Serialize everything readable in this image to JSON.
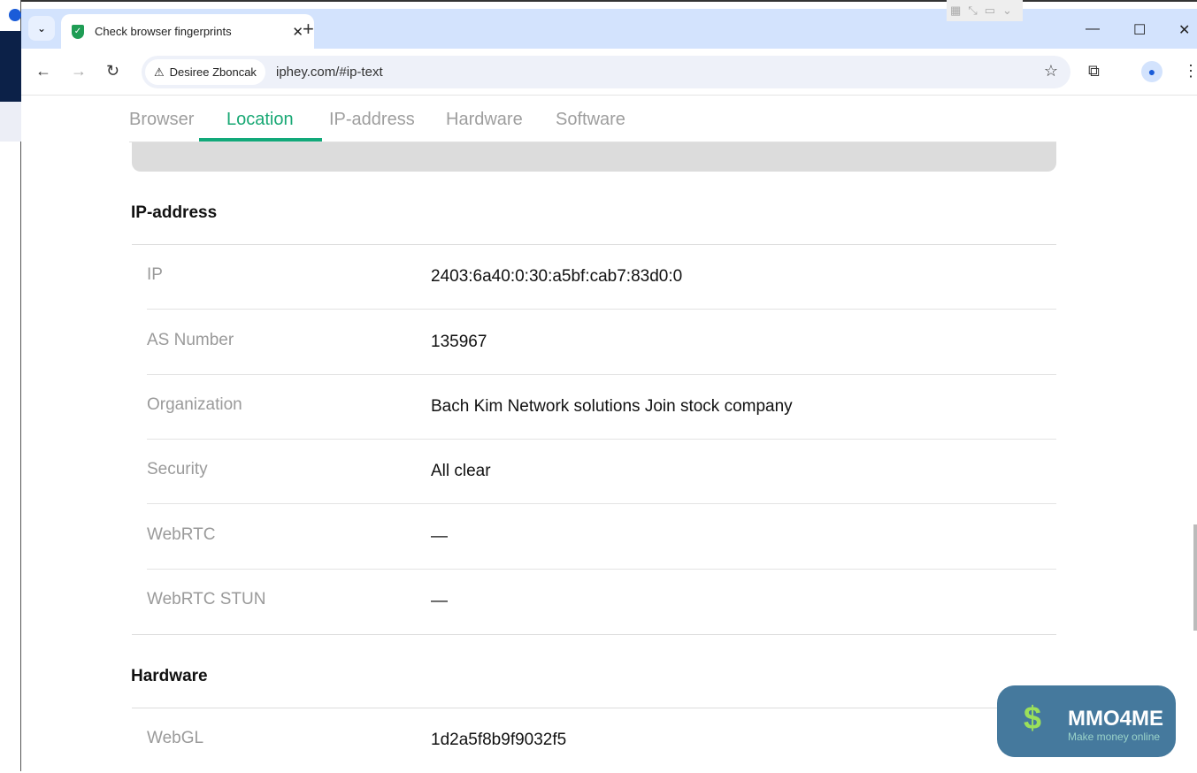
{
  "browser": {
    "tab_title": "Check browser fingerprints",
    "profile_chip": "Desiree Zboncak",
    "url": "iphey.com/#ip-text"
  },
  "nav_tabs": [
    {
      "label": "Browser"
    },
    {
      "label": "Location"
    },
    {
      "label": "IP-address"
    },
    {
      "label": "Hardware"
    },
    {
      "label": "Software"
    }
  ],
  "active_tab": "Location",
  "ip_section": {
    "title": "IP-address",
    "rows": [
      {
        "label": "IP",
        "value": "2403:6a40:0:30:a5bf:cab7:83d0:0"
      },
      {
        "label": "AS Number",
        "value": "135967"
      },
      {
        "label": "Organization",
        "value": "Bach Kim Network solutions Join stock company"
      },
      {
        "label": "Security",
        "value": "All clear"
      },
      {
        "label": "WebRTC",
        "value": "—"
      },
      {
        "label": "WebRTC STUN",
        "value": "—"
      }
    ]
  },
  "hardware_section": {
    "title": "Hardware",
    "rows": [
      {
        "label": "WebGL",
        "value": "1d2a5f8b9f9032f5"
      }
    ]
  },
  "watermark": {
    "title": "MMO4ME",
    "subtitle": "Make money online"
  },
  "colors": {
    "accent": "#12a97a",
    "tabbar": "#d3e3fd"
  }
}
